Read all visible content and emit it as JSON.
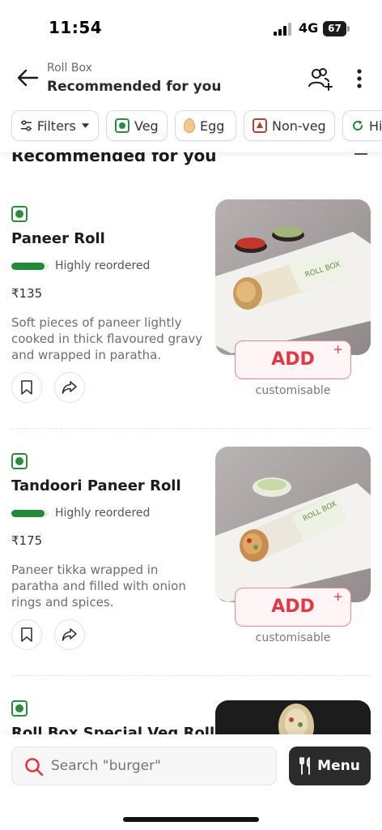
{
  "status_bar": {
    "time": "11:54",
    "network": "4G",
    "battery": "67"
  },
  "header": {
    "subtitle": "Roll Box",
    "title": "Recommended for you"
  },
  "filters": [
    {
      "label": "Filters"
    },
    {
      "label": "Veg"
    },
    {
      "label": "Egg"
    },
    {
      "label": "Non-veg"
    },
    {
      "label": "Hi"
    }
  ],
  "section": {
    "heading": "Recommended for you"
  },
  "items": [
    {
      "name": "Paneer Roll",
      "reorder_text": "Highly reordered",
      "reorder_level": 0.9,
      "price": "₹135",
      "description": "Soft pieces of paneer lightly cooked in thick flavoured gravy and wrapped in paratha.",
      "add_label": "ADD",
      "add_plus": "+",
      "customisable": "customisable"
    },
    {
      "name": "Tandoori Paneer Roll",
      "reorder_text": "Highly reordered",
      "reorder_level": 0.9,
      "price": "₹175",
      "description": "Paneer tikka wrapped in paratha and filled with onion rings and spices.",
      "add_label": "ADD",
      "add_plus": "+",
      "customisable": "customisable"
    },
    {
      "name": "Roll Box Special Veg Roll"
    }
  ],
  "bottom": {
    "search_placeholder": "Search \"burger\"",
    "menu_label": "Menu"
  },
  "colors": {
    "accent": "#e23744",
    "veg": "#2e8b3d",
    "nonveg": "#a64a2f",
    "dark": "#2b2b2b"
  }
}
